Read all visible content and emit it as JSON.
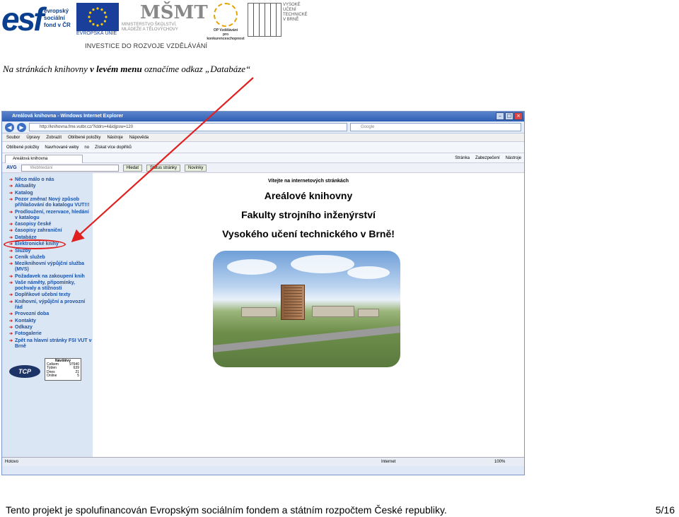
{
  "logos": {
    "esf_big": "esf",
    "esf_small": [
      "evropský",
      "sociální",
      "fond v ČR"
    ],
    "eu_caption": "EVROPSKÁ UNIE",
    "msmt_mark": "MŠMT",
    "msmt_caption": [
      "MINISTERSTVO ŠKOLSTVÍ,",
      "MLÁDEŽE A TĚLOVÝCHOVY"
    ],
    "op_caption": [
      "OP Vzdělávání",
      "pro konkurenceschopnost"
    ],
    "vut_caption": [
      "VYSOKÉ",
      "UČENÍ",
      "TECHNICKÉ",
      "V BRNĚ"
    ],
    "invest": "INVESTICE DO ROZVOJE VZDĚLÁVÁNÍ"
  },
  "heading": {
    "before": "Na stránkách knihovny ",
    "bold": "v levém menu",
    "after": " označíme odkaz „Databáze“"
  },
  "browser": {
    "title": "Areálová knihovna - Windows Internet Explorer",
    "url": "http://knihovna.fme.vutbr.cz/?iddrs=4&idjpsw=120",
    "search_placeholder": "Google",
    "menu": [
      "Soubor",
      "Úpravy",
      "Zobrazit",
      "Oblíbené položky",
      "Nástroje",
      "Nápověda"
    ],
    "favorites": [
      "Oblíbené položky",
      "Navrhované weby",
      "no",
      "Získat více doplňků"
    ],
    "tab": "Areálová knihovna",
    "tools": [
      "Stránka",
      "Zabezpečení",
      "Nástroje"
    ],
    "avg": {
      "brand": "AVG",
      "search_placeholder": "Webhledání",
      "buttons": [
        "Hledat",
        "Status stránky",
        "Novinky"
      ]
    },
    "sidebar_items": [
      "Něco málo o nás",
      "Aktuality",
      "Katalog",
      "Pozor změna! Nový způsob přihlašování do katalogu VUT!!!",
      "Prodloužení, rezervace, hledání v katalogu",
      "časopisy české",
      "časopisy zahraniční",
      "Databáze",
      "Elektronické knihy",
      "Služby",
      "Ceník služeb",
      "Meziknihovní výpůjční služba (MVS)",
      "Požadavek na zakoupení knih",
      "Vaše náměty, připomínky, pochvaly a stížnosti",
      "Doplňkové učební texty",
      "Knihovní, výpůjční a provozní řád",
      "Provozní doba",
      "Kontakty",
      "Odkazy",
      "Fotogalerie",
      "Zpět na hlavní stránky FSI VUT v Brně"
    ],
    "counter": {
      "header": "Návštěvy",
      "rows": [
        [
          "Celkem",
          "97640"
        ],
        [
          "Týden",
          "639"
        ],
        [
          "Dnes",
          "21"
        ],
        [
          "Online",
          "5"
        ]
      ]
    },
    "tcp_logo": "TCP",
    "main": {
      "welcome": "Vítejte na internetových stránkách",
      "line1": "Areálové knihovny",
      "line2": "Fakulty strojního inženýrství",
      "line3": "Vysokého učení technického v Brně!"
    },
    "status": {
      "left": "Hotovo",
      "zone": "Internet",
      "zoom": "100%"
    }
  },
  "footer": {
    "text": "Tento projekt je spolufinancován Evropským sociálním fondem a státním rozpočtem České republiky.",
    "page": "5/16"
  },
  "colors": {
    "annotation": "#e02020",
    "link": "#1a52a8",
    "sidebar_bg": "#dbe6f4"
  }
}
